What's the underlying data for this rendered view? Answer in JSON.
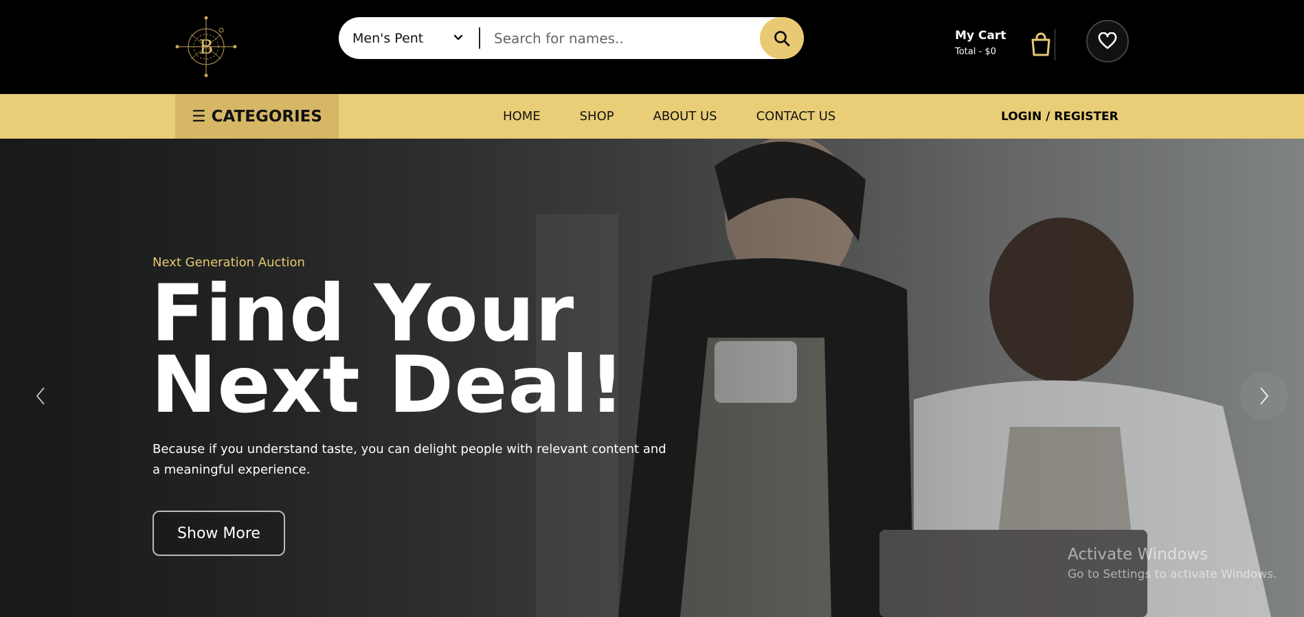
{
  "header": {
    "logo_letter": "B",
    "search": {
      "category_value": "Men's Pent",
      "placeholder": "Search for names.."
    },
    "cart": {
      "title": "My Cart",
      "total": "Total - $0"
    },
    "icons": {
      "search": "search-icon",
      "bag": "shopping-bag-icon",
      "wishlist": "heart-icon",
      "category_dropdown": "chevron-down-icon"
    }
  },
  "nav": {
    "categories_label": "CATEGORIES",
    "links": [
      "HOME",
      "SHOP",
      "ABOUT US",
      "CONTACT US"
    ],
    "login_label": "LOGIN / REGISTER"
  },
  "hero": {
    "eyebrow": "Next Generation Auction",
    "headline_line1": "Find Your",
    "headline_line2": "Next Deal!",
    "subtext": "Because if you understand taste, you can delight people with relevant content and a meaningful experience.",
    "cta_label": "Show More"
  },
  "watermark": {
    "line1": "Activate Windows",
    "line2": "Go to Settings to activate Windows."
  },
  "colors": {
    "accent_gold": "#e9c973",
    "nav_bg": "#e9cd77",
    "categories_bg": "#d6b766",
    "header_bg": "#000000"
  }
}
